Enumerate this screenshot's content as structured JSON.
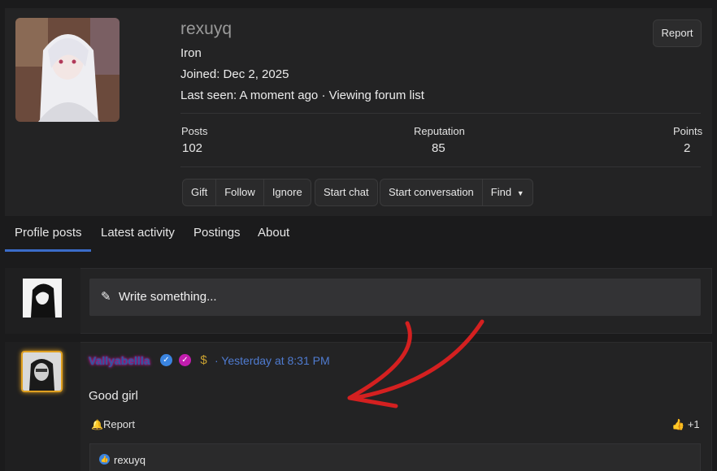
{
  "profile": {
    "username": "rexuyq",
    "rank": "Iron",
    "joined": "Joined: Dec 2, 2025",
    "last_seen": "Last seen: A moment ago · Viewing forum list",
    "report_label": "Report"
  },
  "stats": {
    "posts_label": "Posts",
    "posts_value": "102",
    "reputation_label": "Reputation",
    "reputation_value": "85",
    "points_label": "Points",
    "points_value": "2"
  },
  "actions": {
    "gift": "Gift",
    "follow": "Follow",
    "ignore": "Ignore",
    "start_chat": "Start chat",
    "start_conversation": "Start conversation",
    "find": "Find"
  },
  "tabs": [
    "Profile posts",
    "Latest activity",
    "Postings",
    "About"
  ],
  "compose": {
    "placeholder": "Write something..."
  },
  "post": {
    "author": "Vallyabellla",
    "time": "· Yesterday at 8:31 PM",
    "body": "Good girl",
    "report_label": "Report",
    "like_count": "+1",
    "liked_by": "rexuyq"
  },
  "colors": {
    "accent": "#3b6cc9",
    "link": "#4f7bd0",
    "annotation_arrow": "#d42020"
  }
}
